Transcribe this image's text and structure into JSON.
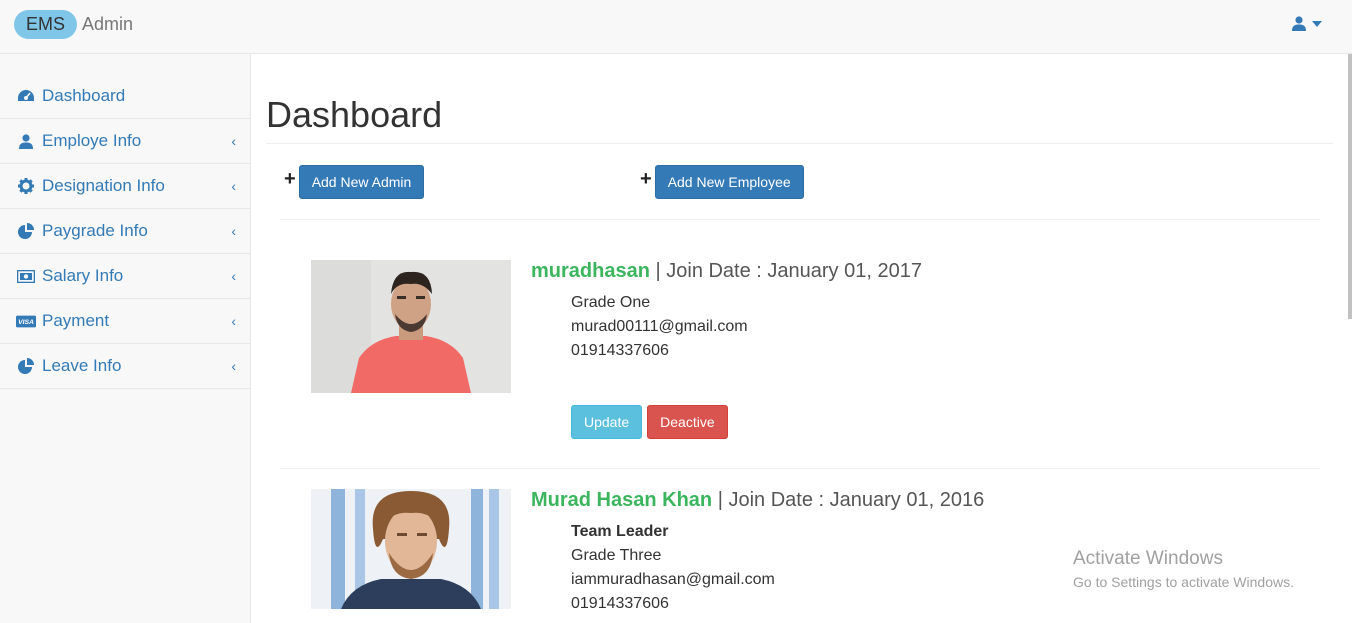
{
  "navbar": {
    "brand_pill": "EMS",
    "brand_text": "Admin",
    "user_icon": "user-icon"
  },
  "sidebar": {
    "items": [
      {
        "label": "Dashboard",
        "icon": "dashboard-icon",
        "has_submenu": false
      },
      {
        "label": "Employe Info",
        "icon": "user-icon",
        "has_submenu": true
      },
      {
        "label": "Designation Info",
        "icon": "gear-icon",
        "has_submenu": true
      },
      {
        "label": "Paygrade Info",
        "icon": "pie-chart-icon",
        "has_submenu": true
      },
      {
        "label": "Salary Info",
        "icon": "money-icon",
        "has_submenu": true
      },
      {
        "label": "Payment",
        "icon": "visa-card-icon",
        "has_submenu": true
      },
      {
        "label": "Leave Info",
        "icon": "pie-chart-icon",
        "has_submenu": true
      }
    ],
    "chevron": "‹"
  },
  "main": {
    "title": "Dashboard",
    "plus": "+",
    "add_admin_label": "Add New Admin",
    "add_employee_label": "Add New Employee",
    "employees": [
      {
        "name": "muradhasan",
        "join_text": " | Join Date : January 01, 2017",
        "designation": "",
        "grade": "Grade One",
        "email": "murad00111@gmail.com",
        "phone": "01914337606",
        "update_label": "Update",
        "deactive_label": "Deactive"
      },
      {
        "name": "Murad Hasan Khan",
        "join_text": " | Join Date : January 01, 2016",
        "designation": "Team Leader",
        "grade": "Grade Three",
        "email": "iammuradhasan@gmail.com",
        "phone": "01914337606"
      }
    ]
  },
  "watermark": {
    "line1": "Activate Windows",
    "line2": "Go to Settings to activate Windows."
  },
  "colors": {
    "link": "#337ab7",
    "name_green": "#3cb55e",
    "info": "#5bc0de",
    "danger": "#d9534f"
  }
}
